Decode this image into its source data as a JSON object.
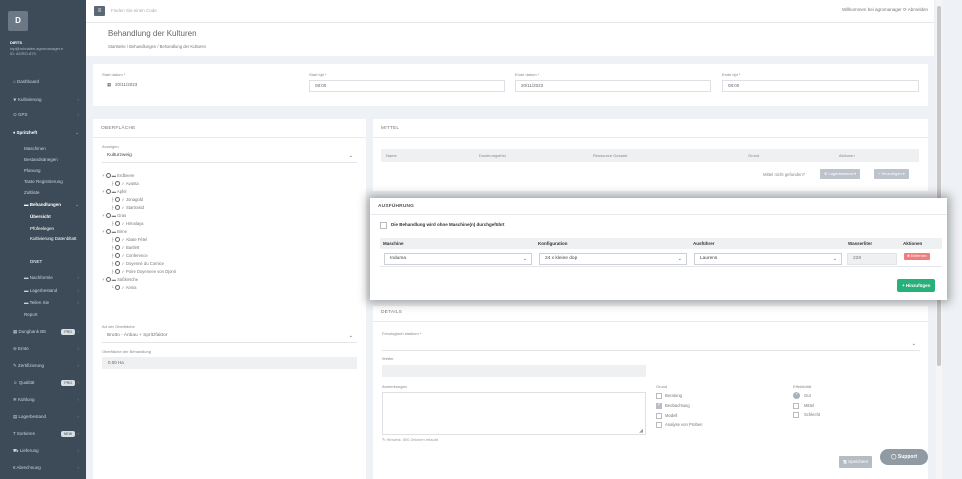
{
  "sidebar": {
    "logo": "D",
    "user": {
      "name": "DIRTS",
      "email": "top@ruhdalen.agromanager.e",
      "id": "ID: AGRO-870"
    },
    "items": [
      {
        "label": "Dashboard",
        "icon": "home-icon"
      },
      {
        "label": "Kultivierung",
        "icon": "leaf-icon"
      },
      {
        "label": "GPS",
        "icon": "pin-icon"
      },
      {
        "label": "Spritzheft",
        "icon": "drop-icon"
      },
      {
        "label": "Maschinen"
      },
      {
        "label": "Bestandsänegen"
      },
      {
        "label": "Planung"
      },
      {
        "label": "Taste Registrierung"
      },
      {
        "label": "Zoltliste"
      },
      {
        "label": "Behandlungen"
      },
      {
        "label": "Übersicht"
      },
      {
        "label": "Pfüfeelegen"
      },
      {
        "label": "Kultivierung Datenbltatt"
      },
      {
        "label": "DNET"
      },
      {
        "label": "Nachformle"
      },
      {
        "label": "Lagerbestand"
      },
      {
        "label": "Teilen Sie"
      },
      {
        "label": "Report"
      },
      {
        "label": "Dungbank BE",
        "badge": "PRO"
      },
      {
        "label": "Ernte"
      },
      {
        "label": "Zertifizierung"
      },
      {
        "label": "Qualität",
        "badge": "PRO"
      },
      {
        "label": "Kühlung"
      },
      {
        "label": "Lagerbestand"
      },
      {
        "label": "Sortieren",
        "badge": "NEW"
      },
      {
        "label": "Lieferung"
      },
      {
        "label": "Abrechnung"
      }
    ]
  },
  "topbar": {
    "search_placeholder": "Finden Sie einen Code",
    "right": "Willkommen bei agromanager   ⟳ Abmelden"
  },
  "page": {
    "title": "Behandlung der Kulturen",
    "breadcrumb": "Startseite  /  Behandlungen  /  Behandlung der Kulturen"
  },
  "dates": {
    "start_date_label": "Start datum *",
    "start_date": "20/11/2023",
    "start_time_label": "Start bjd *",
    "start_time": "08:00",
    "end_date_label": "Ende datum *",
    "end_date": "20/11/2023",
    "end_time_label": "Ende bjd *",
    "end_time": "08:00"
  },
  "surface": {
    "title": "OBERFLÄCHE",
    "show_label": "Anzeigen",
    "show_value": "Kulturzweig",
    "tree": [
      "Erdbeere",
      "Avanta",
      "Apfel",
      "Jonagold",
      "Startrasid",
      "Gras",
      "Himalaya",
      "Birne",
      "Abate Fétel",
      "Bartlett",
      "Conference",
      "Doyenné du Comice",
      "Poire Doyennee von Djonri",
      "Süßkirsche",
      "Annia"
    ],
    "type_label": "Art der Oberfläche",
    "type_value": "Brutto - Anbau + Spritzfaktor",
    "area_label": "Oberfläche der Behandlung",
    "area_value": "0.00 Ha"
  },
  "mittel": {
    "title": "MITTEL",
    "headers": [
      "Name",
      "Dosierungsfrist",
      "Ressource Gesamt",
      "Grund",
      "Aktionen"
    ],
    "not_found": "Mittel nicht gefunden?",
    "stock_btn": "⊕ Lagerbestand ▾",
    "add_btn": "+ Hinzufügen ▾"
  },
  "execution": {
    "title": "AUSFÜHRUNG",
    "no_machine_label": "Die Behandlung wird ohne Maschine(n) durchgeführt",
    "headers": [
      "Maschine",
      "Konfiguration",
      "Ausführer",
      "Wasserliter",
      "Aktionen"
    ],
    "row": {
      "machine": "Induma",
      "config": "24 x kleine dop",
      "executor": "Laurens",
      "water": "228",
      "remove_btn": "✖ Entfernen"
    },
    "add_btn": "+ Hinzufügen"
  },
  "details": {
    "title": "DETAILS",
    "stage_label": "Fenologisch stadium *",
    "weather_label": "Wetter",
    "notes_label": "Anmerkungen",
    "notes_placeholder": "",
    "notes_hint": "✎ Hinweis: 500 Zeichen erlaubt",
    "reason_label": "Grund",
    "reasons": [
      {
        "label": "Beratung",
        "checked": false
      },
      {
        "label": "Beobachtung",
        "checked": true
      },
      {
        "label": "Modell",
        "checked": false
      },
      {
        "label": "Analyse von Proben",
        "checked": false
      }
    ],
    "effect_label": "Effektivität",
    "effects": [
      {
        "label": "Gut",
        "checked": true
      },
      {
        "label": "Mittel",
        "checked": false
      },
      {
        "label": "Schlecht",
        "checked": false
      }
    ]
  },
  "save_btn": "🖫 Speichern",
  "support_btn": "◯ Support",
  "colors": {
    "sidebar": "#3d4b58",
    "accent_green": "#26b07a",
    "danger": "#f07c7c"
  }
}
